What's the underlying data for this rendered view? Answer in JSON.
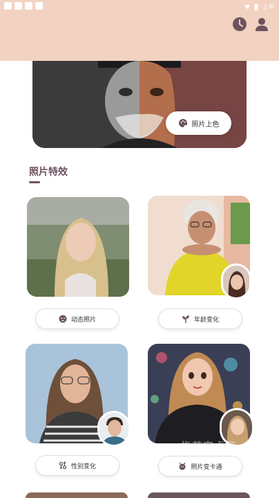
{
  "status_bar": {
    "time": "上午"
  },
  "header": {
    "bg_color": "#f2d2c0",
    "history_icon": "clock-icon",
    "profile_icon": "user-icon"
  },
  "banner": {
    "button_label": "照片上色",
    "button_icon": "palette-icon"
  },
  "section": {
    "title": "照片特效"
  },
  "features": [
    {
      "label": "动态照片",
      "icon": "face-icon"
    },
    {
      "label": "年龄变化",
      "icon": "sprout-icon"
    },
    {
      "label": "性别变化",
      "icon": "gender-icon"
    },
    {
      "label": "照片变卡通",
      "icon": "cartoon-icon"
    }
  ],
  "watermark": "指苗安卓网",
  "colors": {
    "accent": "#6d5360",
    "header": "#f2d2c0"
  }
}
